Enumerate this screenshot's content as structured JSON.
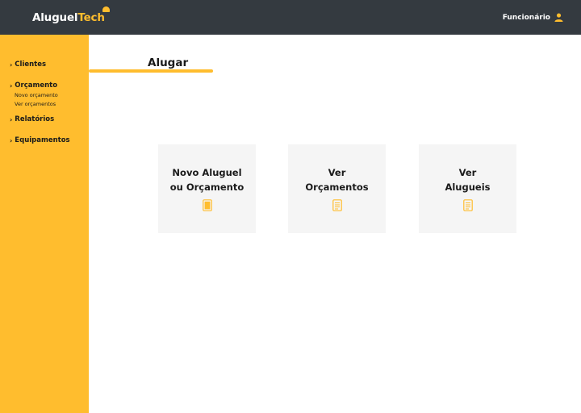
{
  "header": {
    "logo_main": "Aluguel",
    "logo_accent": "Tech",
    "user_label": "Funcionário"
  },
  "sidebar": {
    "items": [
      {
        "label": "Clientes"
      },
      {
        "label": "Orçamento",
        "subitems": [
          "Novo orçamento",
          "Ver orçamentos"
        ]
      },
      {
        "label": "Relatórios"
      },
      {
        "label": "Equipamentos"
      }
    ]
  },
  "main": {
    "title": "Alugar",
    "cards": [
      {
        "label": "Novo Aluguel\nou Orçamento",
        "icon": "document-icon"
      },
      {
        "label": "Ver\nOrçamentos",
        "icon": "document-outline-icon"
      },
      {
        "label": "Ver\nAlugueis",
        "icon": "document-outline-icon"
      }
    ]
  },
  "colors": {
    "accent": "#ffbd2e",
    "header_bg": "#343a40",
    "card_bg": "#f5f5f5"
  }
}
